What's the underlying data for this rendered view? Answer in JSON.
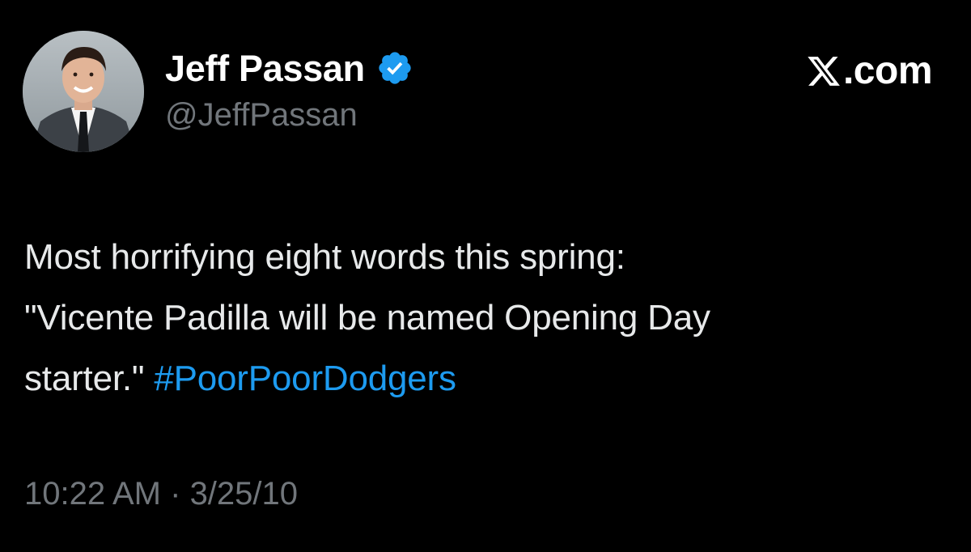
{
  "brand": {
    "logo_icon": "x-logo-icon",
    "text": ".com"
  },
  "author": {
    "display_name": "Jeff Passan",
    "handle": "@JeffPassan",
    "verified": true,
    "verified_icon": "verified-badge-icon",
    "avatar_icon": "profile-photo"
  },
  "tweet": {
    "line1": "Most horrifying eight words this spring:",
    "line2": "\"Vicente Padilla will be named Opening Day",
    "line3_text": "starter.\" ",
    "hashtag": "#PoorPoorDodgers"
  },
  "meta": {
    "time": "10:22 AM",
    "separator": " · ",
    "date": "3/25/10"
  },
  "colors": {
    "background": "#000000",
    "primary_text": "#e7e9ea",
    "secondary_text": "#71767b",
    "accent": "#1d9bf0"
  }
}
